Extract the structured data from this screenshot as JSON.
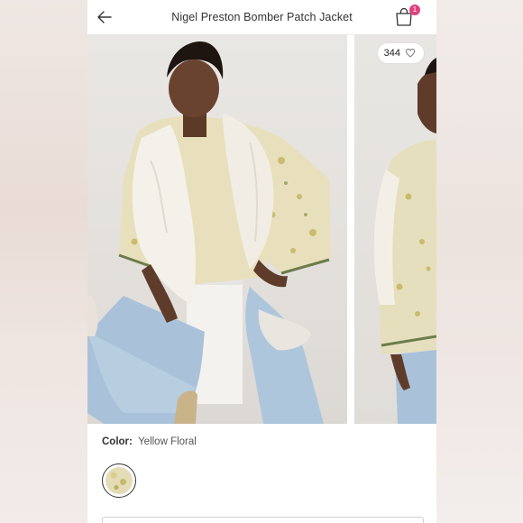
{
  "header": {
    "title": "Nigel Preston Bomber Patch Jacket",
    "cart_count": "1"
  },
  "gallery": {
    "like_count": "344"
  },
  "product": {
    "color_label": "Color:",
    "color_value": "Yellow Floral"
  },
  "icons": [
    "arrow-left-icon",
    "shopping-bag-icon",
    "heart-icon"
  ],
  "colors": {
    "badge": "#e0417e",
    "text": "#333333"
  }
}
